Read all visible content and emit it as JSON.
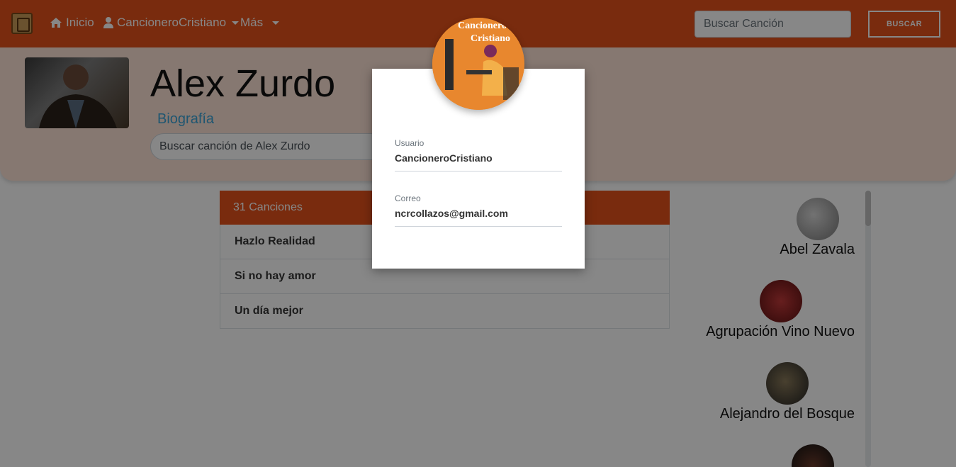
{
  "navbar": {
    "home_label": "Inicio",
    "user_label": "CancioneroCristiano",
    "more_label": "Más",
    "search_placeholder": "Buscar Canción",
    "search_button": "BUSCAR"
  },
  "artist": {
    "name": "Alex Zurdo",
    "bio_link": "Biografía",
    "search_placeholder": "Buscar canción de Alex Zurdo"
  },
  "songs": {
    "header": "31 Canciones",
    "items": [
      "Hazlo Realidad",
      "Si no hay amor",
      "Un día mejor"
    ]
  },
  "related_artists": [
    "Abel Zavala",
    "Agrupación Vino Nuevo",
    "Alejandro del Bosque"
  ],
  "modal": {
    "logo_text_line1": "Cancionero",
    "logo_text_line2": "Cristiano",
    "user_label": "Usuario",
    "user_value": "CancioneroCristiano",
    "email_label": "Correo",
    "email_value": "ncrcollazos@gmail.com"
  },
  "colors": {
    "primary": "#e4521c",
    "header_bg": "#fde3d6",
    "link": "#3ba3d6"
  }
}
